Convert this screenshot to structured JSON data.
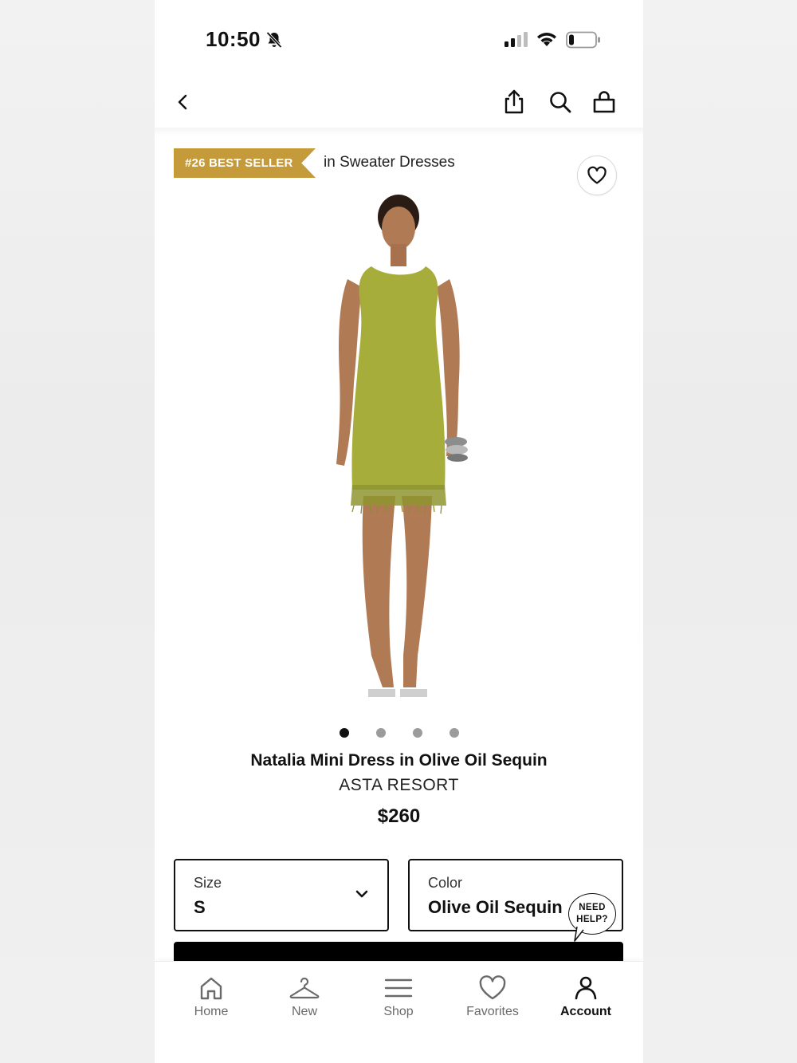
{
  "status_bar": {
    "time": "10:50"
  },
  "badge": {
    "rank_label": "#26 BEST SELLER",
    "category_text": "in Sweater Dresses"
  },
  "product": {
    "name": "Natalia Mini Dress in Olive Oil Sequin",
    "brand": "ASTA RESORT",
    "price": "$260",
    "image_count": 4,
    "active_image_index": 0
  },
  "selectors": {
    "size": {
      "label": "Size",
      "value": "S"
    },
    "color": {
      "label": "Color",
      "value": "Olive Oil Sequin"
    }
  },
  "help": {
    "line1": "NEED",
    "line2": "HELP?"
  },
  "tabs": [
    {
      "label": "Home",
      "icon": "home-icon"
    },
    {
      "label": "New",
      "icon": "hanger-icon"
    },
    {
      "label": "Shop",
      "icon": "menu-icon"
    },
    {
      "label": "Favorites",
      "icon": "heart-icon"
    },
    {
      "label": "Account",
      "icon": "person-icon",
      "active": true
    }
  ],
  "colors": {
    "badge": "#c49a3a",
    "dress": "#a7ad3a",
    "cta": "#000000"
  }
}
